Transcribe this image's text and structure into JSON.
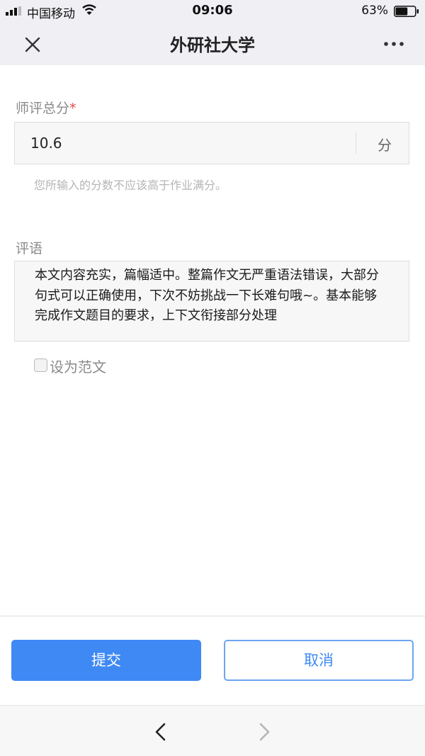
{
  "status_bar": {
    "carrier": "中国移动",
    "time": "09:06",
    "battery_percent": "63%",
    "battery_level": 0.63,
    "icons": [
      "signal-icon",
      "wifi-icon",
      "battery-icon"
    ]
  },
  "nav": {
    "title": "外研社大学",
    "icons": [
      "close-icon",
      "more-icon"
    ]
  },
  "form": {
    "score_label": "师评总分",
    "required_mark": "*",
    "score_value": "10.6",
    "score_unit": "分",
    "score_hint": "您所输入的分数不应该高于作业满分。",
    "comment_label": "评语",
    "comment_text": "本文内容充实，篇幅适中。整篇作文无严重语法错误，大部分句式可以正确使用，下次不妨挑战一下长难句哦~。基本能够完成作文题目的要求，上下文衔接部分处理",
    "set_example_label": "设为范文",
    "set_example_checked": false
  },
  "actions": {
    "submit_label": "提交",
    "cancel_label": "取消"
  },
  "toolbar": {
    "icons": [
      "back-chevron-icon",
      "forward-chevron-icon"
    ]
  },
  "colors": {
    "primary": "#3f89f5",
    "required": "#e54b4b",
    "bar_background": "#efeff4"
  }
}
